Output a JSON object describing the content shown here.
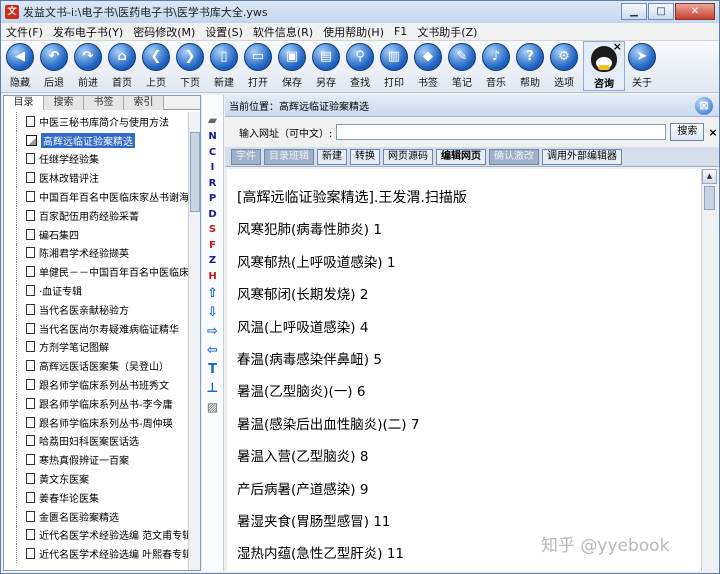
{
  "window": {
    "title": "发益文书-i:\\电子书\\医药电子书\\医学书库大全.yws"
  },
  "menu": [
    "文件(F)",
    "发布电子书(Y)",
    "密码修改(M)",
    "设置(S)",
    "软件信息(R)",
    "使用帮助(H)",
    "F1",
    "文书助手(Z)"
  ],
  "toolbar": {
    "items": [
      {
        "label": "隐藏",
        "icon": "hide-icon",
        "glyph": "◀"
      },
      {
        "label": "后退",
        "icon": "back-arrow-icon",
        "glyph": "↶"
      },
      {
        "label": "前进",
        "icon": "forward-arrow-icon",
        "glyph": "↷"
      },
      {
        "label": "首页",
        "icon": "home-icon",
        "glyph": "⌂"
      },
      {
        "label": "上页",
        "icon": "prev-page-icon",
        "glyph": "❮"
      },
      {
        "label": "下页",
        "icon": "next-page-icon",
        "glyph": "❯"
      },
      {
        "label": "新建",
        "icon": "new-document-icon",
        "glyph": "▯"
      },
      {
        "label": "打开",
        "icon": "open-icon",
        "glyph": "▭"
      },
      {
        "label": "保存",
        "icon": "save-icon",
        "glyph": "▣"
      },
      {
        "label": "另存",
        "icon": "save-as-icon",
        "glyph": "▤"
      },
      {
        "label": "查找",
        "icon": "search-icon",
        "glyph": "⚲"
      },
      {
        "label": "打印",
        "icon": "print-icon",
        "glyph": "▥"
      },
      {
        "label": "书签",
        "icon": "bookmark-icon",
        "glyph": "◆"
      },
      {
        "label": "笔记",
        "icon": "note-icon",
        "glyph": "✎"
      },
      {
        "label": "音乐",
        "icon": "music-icon",
        "glyph": "♪"
      },
      {
        "label": "帮助",
        "icon": "help-icon",
        "glyph": "?"
      },
      {
        "label": "选项",
        "icon": "options-gear-icon",
        "glyph": "⚙"
      }
    ],
    "qq": {
      "label": "咨询",
      "close": "×",
      "icon": "qq-penguin-icon"
    },
    "about": {
      "label": "关于",
      "icon": "about-cursor-icon",
      "glyph": "➤"
    }
  },
  "left_tabs": [
    "目录",
    "搜索",
    "书签",
    "索引"
  ],
  "tree": [
    "中医三秘书库简介与使用方法",
    "高辉远临证验案精选",
    "任继学经验集",
    "医林改错评注",
    "中国百年百名中医临床家丛书谢海洲",
    "百家配伍用药经验采菁",
    "碥石集四",
    "陈湘君学术经验撷英",
    "单健民－－中国百年百名中医临床家",
    "·血证专辑",
    "当代名医亲献秘验方",
    "当代名医尚尔寿疑难病临证精华",
    "方剂学笔记图解",
    "高辉远医话医案集（吴登山）",
    "跟名师学临床系列丛书班秀文",
    "跟名师学临床系列丛书-李今庸",
    "跟名师学临床系列丛书-周仲瑛",
    "哈荔田妇科医案医话选",
    "寒热真假辨证一百案",
    "黄文东医案",
    "姜春华论医集",
    "金匮名医验案精选",
    "近代名医学术经验选编 范文甫专辑",
    "近代名医学术经验选编 叶熙春专辑"
  ],
  "selected_tree_index": 1,
  "nav_strip": {
    "letters": [
      {
        "t": "N",
        "red": false
      },
      {
        "t": "C",
        "red": false
      },
      {
        "t": "I",
        "red": false
      },
      {
        "t": "R",
        "red": false
      },
      {
        "t": "P",
        "red": false
      },
      {
        "t": "D",
        "red": false
      },
      {
        "t": "S",
        "red": true
      },
      {
        "t": "F",
        "red": true
      },
      {
        "t": "Z",
        "red": false
      },
      {
        "t": "H",
        "red": true
      }
    ],
    "arrows": [
      "⇧",
      "⇩",
      "⇨",
      "⇦",
      "T",
      "⊥"
    ]
  },
  "location": {
    "label": "当前位置：",
    "value": "高辉远临证验案精选"
  },
  "url_bar": {
    "label": "输入网址（可中文）:",
    "value": "",
    "search_label": "搜索",
    "close": "×"
  },
  "editbar": [
    {
      "label": "字件",
      "disabled": true,
      "bold": false
    },
    {
      "label": "目录班辑",
      "disabled": true,
      "bold": false
    },
    {
      "label": "新建",
      "disabled": false,
      "bold": false
    },
    {
      "label": "转换",
      "disabled": false,
      "bold": false
    },
    {
      "label": "网页源码",
      "disabled": false,
      "bold": false
    },
    {
      "label": "编辑网页",
      "disabled": false,
      "bold": true
    },
    {
      "label": "确认激改",
      "disabled": true,
      "bold": false
    },
    {
      "label": "调用外部编辑器",
      "disabled": false,
      "bold": false
    }
  ],
  "content": {
    "title": "[高辉远临证验案精选].王发渭.扫描版",
    "entries": [
      "风寒犯肺(病毒性肺炎)   1",
      "风寒郁热(上呼吸道感染)    1",
      "风寒郁闭(长期发烧) 2",
      "风温(上呼吸道感染) 4",
      "春温(病毒感染伴鼻衄)    5",
      "暑温(乙型脑炎)(一) 6",
      "暑温(感染后出血性脑炎)(二)    7",
      "暑温入营(乙型脑炎) 8",
      "产后病暑(产道感染) 9",
      "暑湿夹食(胃肠型感冒)    11",
      "湿热内蕴(急性乙型肝炎)    11"
    ]
  },
  "watermark": "知乎 @yyebook"
}
